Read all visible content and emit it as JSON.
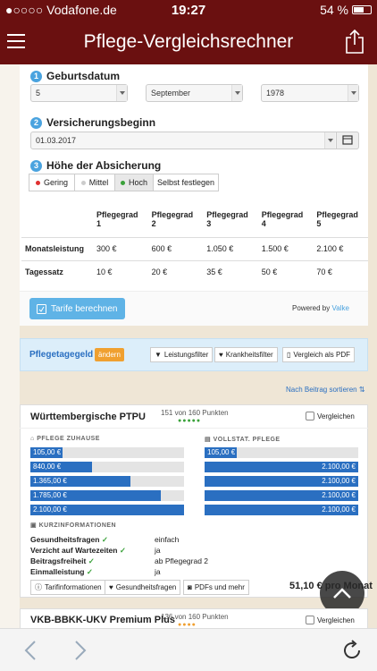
{
  "status": {
    "carrier": "●○○○○ Vodafone.de",
    "time": "19:27",
    "battery": "54 %"
  },
  "nav": {
    "title": "Pflege-Vergleichsrechner"
  },
  "form": {
    "birth_label": "Geburtsdatum",
    "birth_day": "5",
    "birth_month": "September",
    "birth_year": "1978",
    "start_label": "Versicherungsbeginn",
    "start_date": "01.03.2017",
    "cover_label": "Höhe der Absicherung",
    "levels": [
      {
        "label": "Gering",
        "color": "#e03030"
      },
      {
        "label": "Mittel",
        "color": "#cccccc"
      },
      {
        "label": "Hoch",
        "color": "#3aa13a"
      },
      {
        "label": "Selbst festlegen"
      }
    ]
  },
  "table": {
    "headers": [
      "Pflegegrad 1",
      "Pflegegrad 2",
      "Pflegegrad 3",
      "Pflegegrad 4",
      "Pflegegrad 5"
    ],
    "rows": [
      {
        "label": "Monatsleistung",
        "values": [
          "300 €",
          "600 €",
          "1.050 €",
          "1.500 €",
          "2.100 €"
        ]
      },
      {
        "label": "Tagessatz",
        "values": [
          "10 €",
          "20 €",
          "35 €",
          "50 €",
          "70 €"
        ]
      }
    ]
  },
  "calc_button": "Tarife berechnen",
  "powered": {
    "text": "Powered by",
    "brand": "Valke"
  },
  "filter": {
    "title": "Pflegetagegeld",
    "change": "ändern",
    "btn1": "Leistungsfilter",
    "btn2": "Krankheitsfilter",
    "btn3": "Vergleich als PDF"
  },
  "sort_label": "Nach Beitrag sortieren",
  "tariff1": {
    "name": "Württembergische PTPU",
    "score": "151 von 160 Punkten",
    "compare": "Vergleichen",
    "home_title": "PFLEGE ZUHAUSE",
    "full_title": "VOLLSTAT. PFLEGE",
    "home_values": [
      "105,00 €",
      "840,00 €",
      "1.365,00 €",
      "1.785,00 €",
      "2.100,00 €"
    ],
    "home_fractions": [
      0.05,
      0.4,
      0.65,
      0.85,
      1.0
    ],
    "full_values": [
      "105,00 €",
      "2.100,00 €",
      "2.100,00 €",
      "2.100,00 €",
      "2.100,00 €"
    ],
    "full_fractions": [
      0.05,
      1.0,
      1.0,
      1.0,
      1.0
    ],
    "info_title": "KURZINFORMATIONEN",
    "info": [
      {
        "label": "Gesundheitsfragen",
        "value": "einfach"
      },
      {
        "label": "Verzicht auf Wartezeiten",
        "value": "ja"
      },
      {
        "label": "Beitragsfreiheit",
        "value": "ab Pflegegrad 2"
      },
      {
        "label": "Einmalleistung",
        "value": "ja"
      }
    ],
    "link1": "Tarifinformationen",
    "link2": "Gesundheitsfragen",
    "link3": "PDFs und mehr",
    "price": "51,10 € pro Monat"
  },
  "tariff2": {
    "name": "VKB-BBKK-UKV Premium Plus",
    "score": "136 von 160 Punkten",
    "compare": "Vergleichen"
  }
}
